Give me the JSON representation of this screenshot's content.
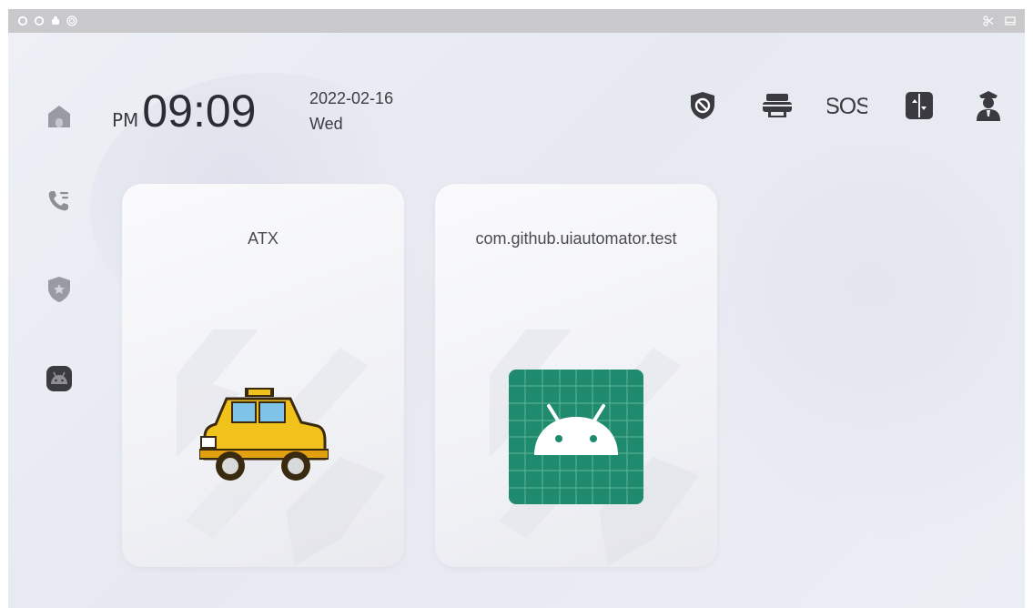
{
  "statusbar": {
    "left_icons": [
      "circle-outline-icon",
      "circle-outline-icon",
      "robot-icon",
      "target-icon"
    ],
    "right_icons": [
      "scissors-icon",
      "tablet-icon"
    ]
  },
  "clock": {
    "ampm": "PM",
    "time": "09:09",
    "date": "2022-02-16",
    "weekday": "Wed"
  },
  "sidebar": {
    "items": [
      {
        "name": "home-icon"
      },
      {
        "name": "call-log-icon"
      },
      {
        "name": "security-shield-icon"
      },
      {
        "name": "android-apps-icon"
      }
    ]
  },
  "top_actions": [
    {
      "name": "shield-block-icon"
    },
    {
      "name": "printer-icon"
    },
    {
      "name": "sos-icon"
    },
    {
      "name": "door-panel-icon"
    },
    {
      "name": "guard-icon"
    }
  ],
  "apps": [
    {
      "label": "ATX",
      "icon": "taxi-icon"
    },
    {
      "label": "com.github.uiautomator.test",
      "icon": "android-icon"
    }
  ],
  "colors": {
    "icon_gray": "#8e8f96",
    "icon_dark": "#3a3a40",
    "android_tile": "#1f8a6d",
    "taxi_yellow": "#f2c21c"
  }
}
